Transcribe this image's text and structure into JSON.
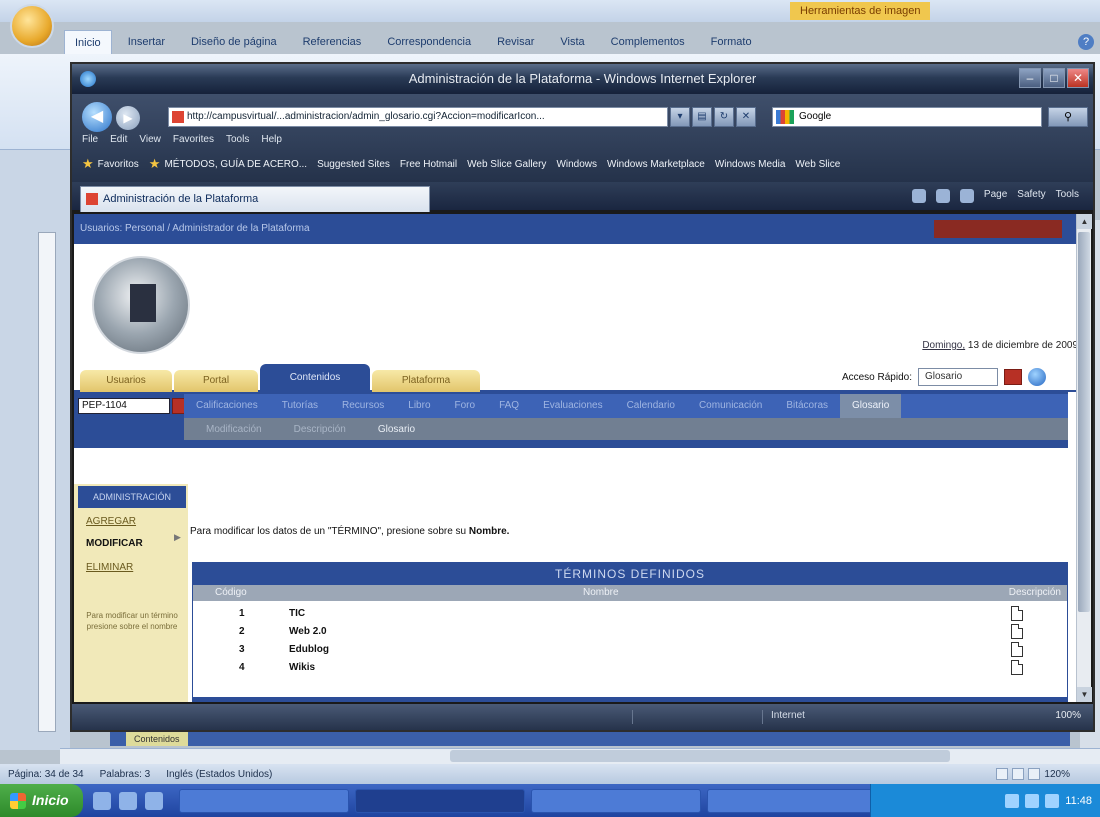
{
  "word": {
    "tooltip": "Herramientas de imagen",
    "tabs": [
      "Inicio",
      "Insertar",
      "Diseño de página",
      "Referencias",
      "Correspondencia",
      "Revisar",
      "Vista",
      "Complementos",
      "Formato"
    ],
    "status_page": "Página: 34 de 34",
    "status_words": "Palabras: 3",
    "status_lang": "Inglés (Estados Unidos)",
    "zoom": "120%",
    "doc_label": "Contenidos"
  },
  "taskbar": {
    "start": "Inicio",
    "tasks": [
      "",
      "",
      "",
      ""
    ],
    "clock": "11:48"
  },
  "ie": {
    "title": "Administración de la Plataforma - Windows Internet Explorer",
    "address": "http://campusvirtual/...administracion/admin_glosario.cgi?Accion=modificarIcon...",
    "search_placeholder": "Google",
    "menu": [
      "File",
      "Edit",
      "View",
      "Favorites",
      "Tools",
      "Help"
    ],
    "favorites": [
      "Favoritos",
      "MÉTODOS, GUÍA DE ACERO...",
      "Suggested Sites",
      "Free Hotmail",
      "Web Slice Gallery",
      "Windows",
      "Windows Marketplace",
      "Windows Media",
      "Web Slice"
    ],
    "tab_title": "Administración de la Plataforma",
    "command": [
      "Page",
      "Safety",
      "Tools"
    ],
    "status_zone": "Internet",
    "status_zoom": "100%"
  },
  "page": {
    "breadcrumb": "Usuarios: Personal / Administrador de la Plataforma",
    "date_day": "Domingo,",
    "date_rest": "13 de diciembre de 2009",
    "main_tabs": [
      "Usuarios",
      "Portal",
      "Contenidos",
      "Plataforma"
    ],
    "quick_access_label": "Acceso Rápido:",
    "quick_access_value": "Glosario",
    "module_select": "PEP-1104",
    "sub_nav": [
      "Calificaciones",
      "Tutorías",
      "Recursos",
      "Libro",
      "Foro",
      "FAQ",
      "Evaluaciones",
      "Calendario",
      "Comunicación",
      "Bitácoras",
      "Glosario"
    ],
    "sub_sub_nav": [
      "Modificación",
      "Descripción",
      "Glosario"
    ],
    "sidebar_title": "ADMINISTRACIÓN",
    "sidebar_items": [
      "AGREGAR",
      "MODIFICAR",
      "ELIMINAR"
    ],
    "sidebar_note": "Para modificar un término presione sobre el nombre",
    "instruction_prefix": "Para modificar los datos de un \"TÉRMINO\", presione sobre su ",
    "instruction_bold": "Nombre.",
    "terms_title": "TÉRMINOS DEFINIDOS",
    "terms_headers": {
      "code": "Código",
      "name": "Nombre",
      "desc": "Descripción"
    },
    "terms": [
      {
        "code": "1",
        "name": "TIC"
      },
      {
        "code": "2",
        "name": "Web 2.0"
      },
      {
        "code": "3",
        "name": "Edublog"
      },
      {
        "code": "4",
        "name": "Wikis"
      }
    ]
  }
}
